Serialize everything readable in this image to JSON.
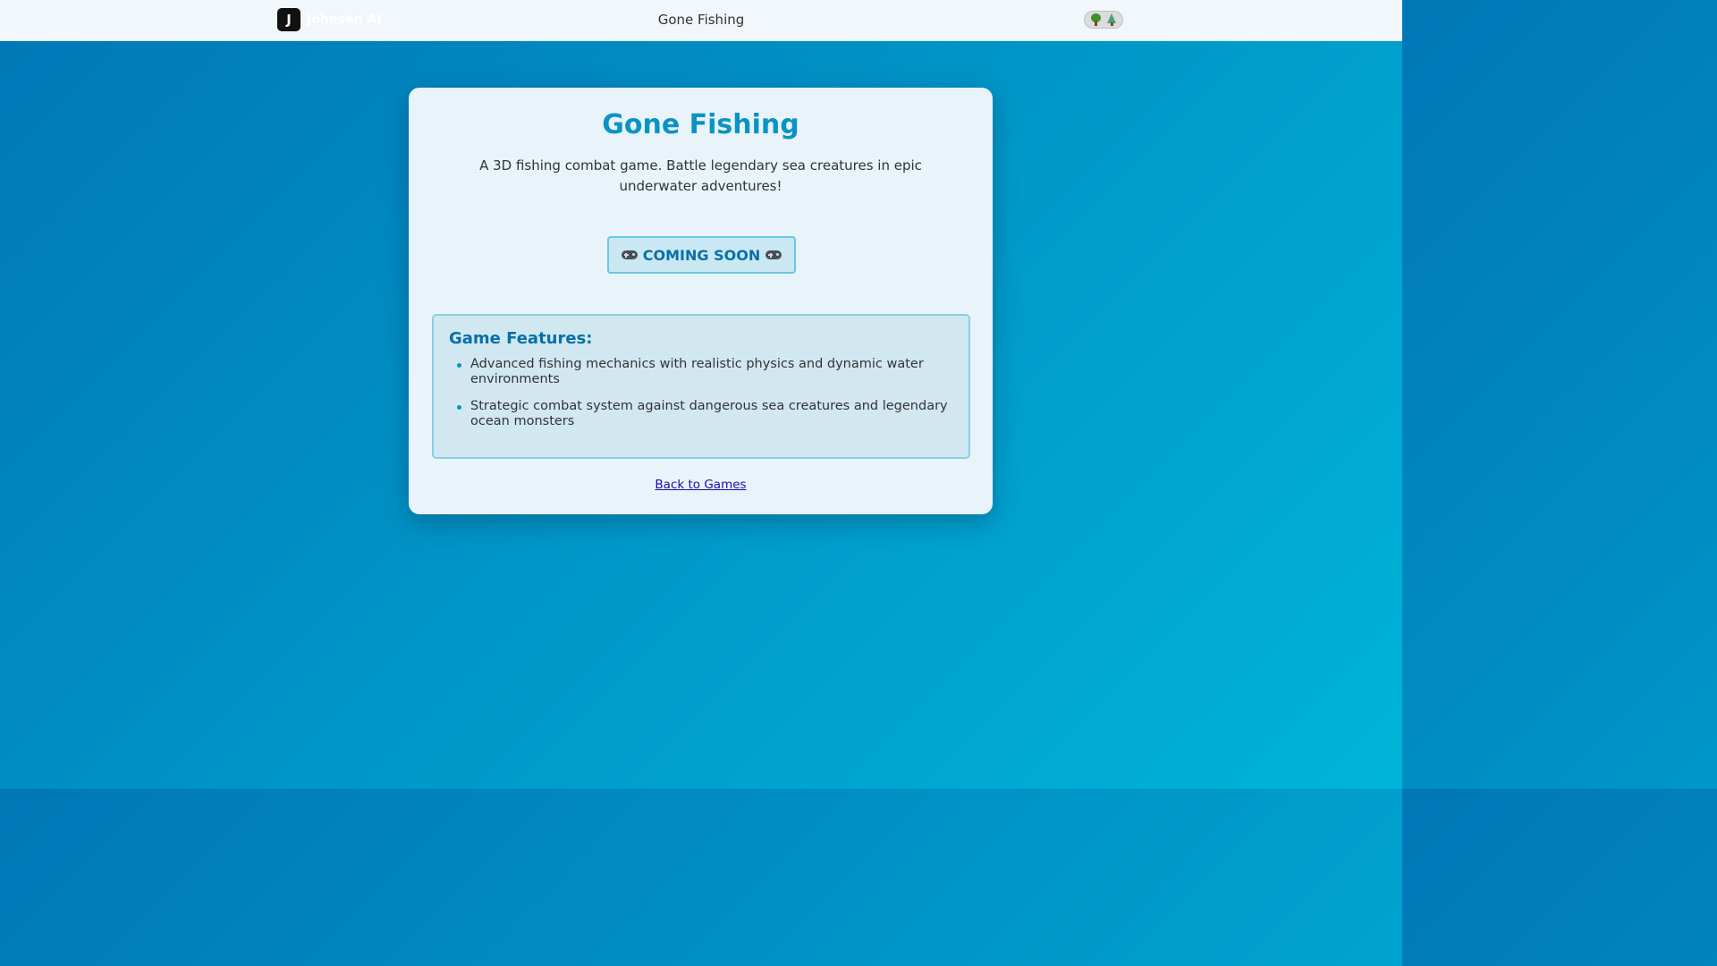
{
  "header": {
    "logo_letter": "J",
    "brand_name": "Johnsen AI",
    "page_title": "Gone Fishing",
    "theme_toggle_icons": [
      "deciduous-tree-icon",
      "evergreen-tree-icon"
    ]
  },
  "game": {
    "title": "Gone Fishing",
    "description": "A 3D fishing combat game. Battle legendary sea creatures in epic underwater adventures!",
    "status_label": "COMING SOON",
    "status_icon": "gamepad-icon",
    "features_title": "Game Features:",
    "features": [
      "Advanced fishing mechanics with realistic physics and dynamic water environments",
      "Strategic combat system against dangerous sea creatures and legendary ocean monsters"
    ],
    "back_link": "Back to Games"
  },
  "colors": {
    "title_blue": "#0a93c4",
    "accent_blue": "#0a6fa8",
    "background_gradient_start": "#0077b6",
    "background_gradient_end": "#00b4d8",
    "link": "#1a0dab"
  }
}
